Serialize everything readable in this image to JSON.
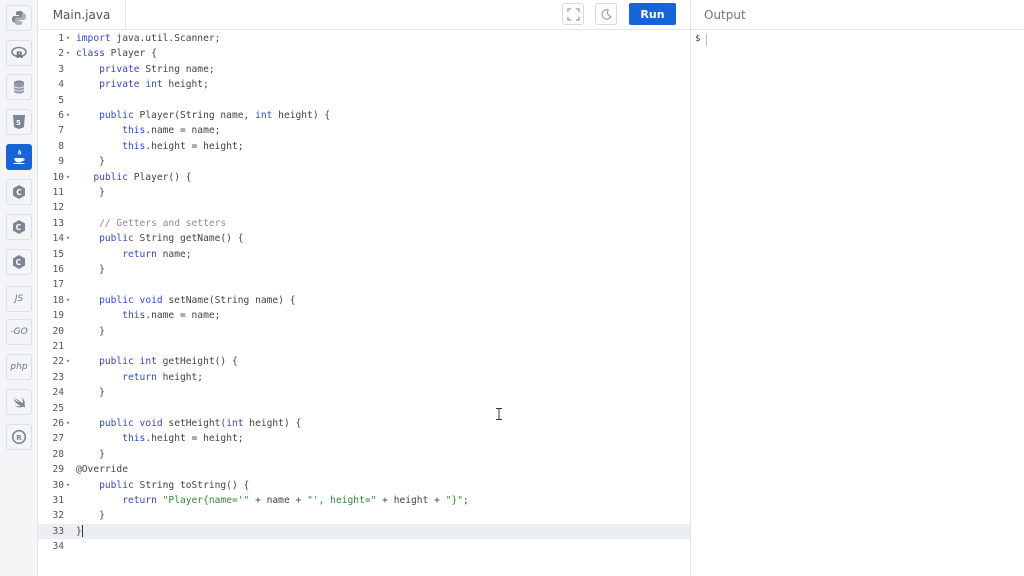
{
  "sidebar": {
    "languages": [
      {
        "name": "python-icon",
        "label": ""
      },
      {
        "name": "r-icon",
        "label": ""
      },
      {
        "name": "sql-icon",
        "label": ""
      },
      {
        "name": "html5-icon",
        "label": ""
      },
      {
        "name": "java-icon",
        "label": "",
        "active": true
      },
      {
        "name": "c-icon",
        "label": ""
      },
      {
        "name": "cpp-icon",
        "label": ""
      },
      {
        "name": "csharp-icon",
        "label": ""
      },
      {
        "name": "js-icon",
        "label": "JS"
      },
      {
        "name": "go-icon",
        "label": "-GO"
      },
      {
        "name": "php-icon",
        "label": "php"
      },
      {
        "name": "swift-icon",
        "label": ""
      },
      {
        "name": "rust-icon",
        "label": ""
      }
    ]
  },
  "header": {
    "file_tab": "Main.java",
    "run_label": "Run",
    "output_label": "Output"
  },
  "output": {
    "prompt": "$"
  },
  "editor": {
    "active_line": 33,
    "lines": [
      {
        "n": "1",
        "fold": true,
        "code": "<span class='kw'>import</span> java.util.Scanner;"
      },
      {
        "n": "2",
        "fold": true,
        "code": "<span class='kw'>class</span> Player {"
      },
      {
        "n": "3",
        "fold": false,
        "code": "    <span class='kw'>private</span> String name;"
      },
      {
        "n": "4",
        "fold": false,
        "code": "    <span class='kw'>private</span> <span class='kw'>int</span> height;"
      },
      {
        "n": "5",
        "fold": false,
        "code": ""
      },
      {
        "n": "6",
        "fold": true,
        "code": "    <span class='kw'>public</span> Player(String name, <span class='kw'>int</span> height) {"
      },
      {
        "n": "7",
        "fold": false,
        "code": "        <span class='kw'>this</span>.name = name;"
      },
      {
        "n": "8",
        "fold": false,
        "code": "        <span class='kw'>this</span>.height = height;"
      },
      {
        "n": "9",
        "fold": false,
        "code": "    }"
      },
      {
        "n": "10",
        "fold": true,
        "code": "   <span class='kw'>public</span> Player() {"
      },
      {
        "n": "11",
        "fold": false,
        "code": "    }"
      },
      {
        "n": "12",
        "fold": false,
        "code": ""
      },
      {
        "n": "13",
        "fold": false,
        "code": "    <span class='cm'>// Getters and setters</span>"
      },
      {
        "n": "14",
        "fold": true,
        "code": "    <span class='kw'>public</span> String getName() {"
      },
      {
        "n": "15",
        "fold": false,
        "code": "        <span class='kw'>return</span> name;"
      },
      {
        "n": "16",
        "fold": false,
        "code": "    }"
      },
      {
        "n": "17",
        "fold": false,
        "code": ""
      },
      {
        "n": "18",
        "fold": true,
        "code": "    <span class='kw'>public</span> <span class='kw'>void</span> setName(String name) {"
      },
      {
        "n": "19",
        "fold": false,
        "code": "        <span class='kw'>this</span>.name = name;"
      },
      {
        "n": "20",
        "fold": false,
        "code": "    }"
      },
      {
        "n": "21",
        "fold": false,
        "code": ""
      },
      {
        "n": "22",
        "fold": true,
        "code": "    <span class='kw'>public</span> <span class='kw'>int</span> getHeight() {"
      },
      {
        "n": "23",
        "fold": false,
        "code": "        <span class='kw'>return</span> height;"
      },
      {
        "n": "24",
        "fold": false,
        "code": "    }"
      },
      {
        "n": "25",
        "fold": false,
        "code": ""
      },
      {
        "n": "26",
        "fold": true,
        "code": "    <span class='kw'>public</span> <span class='kw'>void</span> setHeight(<span class='kw'>int</span> height) {"
      },
      {
        "n": "27",
        "fold": false,
        "code": "        <span class='kw'>this</span>.height = height;"
      },
      {
        "n": "28",
        "fold": false,
        "code": "    }"
      },
      {
        "n": "29",
        "fold": false,
        "code": "@Override"
      },
      {
        "n": "30",
        "fold": true,
        "code": "    <span class='kw'>public</span> String toString() {"
      },
      {
        "n": "31",
        "fold": false,
        "code": "        <span class='kw'>return</span> <span class='str'>\"Player{name='\"</span> + name + <span class='str'>\"', height=\"</span> + height + <span class='str'>\"}\"</span>;"
      },
      {
        "n": "32",
        "fold": false,
        "code": "    }"
      },
      {
        "n": "33",
        "fold": false,
        "code": "}<span class='cursor-caret'></span>"
      },
      {
        "n": "34",
        "fold": false,
        "code": ""
      }
    ]
  }
}
